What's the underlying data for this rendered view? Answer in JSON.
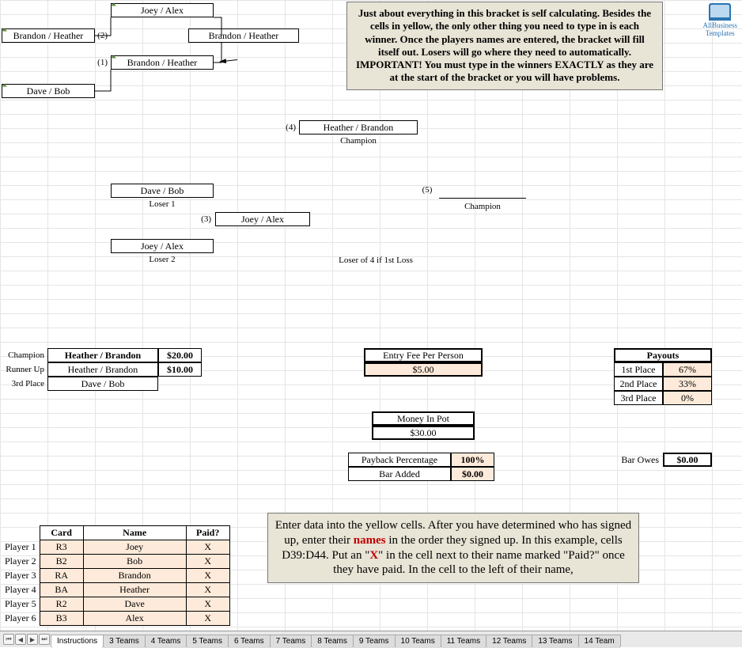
{
  "logo_text": "AllBusiness\nTemplates",
  "bracket": {
    "seed_top_left": "Brandon / Heather",
    "seed_top_right": "Joey / Alex",
    "seed_bot_left": "Dave / Bob",
    "win_r1": "Brandon / Heather",
    "win_r1b": "Brandon / Heather",
    "champ_winner_side": "Heather / Brandon",
    "champ_label": "Champion",
    "loser1_name": "Dave / Bob",
    "loser1_lbl": "Loser 1",
    "loser2_name": "Joey / Alex",
    "loser2_lbl": "Loser 2",
    "losers_final": "Joey / Alex",
    "grand_final_lbl": "Champion",
    "loser4_lbl": "Loser of 4 if 1st Loss",
    "n1": "(1)",
    "n2": "(2)",
    "n3": "(3)",
    "n4": "(4)",
    "n5": "(5)"
  },
  "results": {
    "champion_lbl": "Champion",
    "champion": "Heather / Brandon",
    "champion_pay": "$20.00",
    "runnerup_lbl": "Runner Up",
    "runnerup": "Heather / Brandon",
    "runnerup_pay": "$10.00",
    "third_lbl": "3rd Place",
    "third": "Dave / Bob"
  },
  "money": {
    "entry_lbl": "Entry Fee Per Person",
    "entry_val": "$5.00",
    "pot_lbl": "Money In Pot",
    "pot_val": "$30.00",
    "payback_lbl": "Payback Percentage",
    "payback_val": "100%",
    "baradded_lbl": "Bar Added",
    "baradded_val": "$0.00",
    "barowes_lbl": "Bar Owes",
    "barowes_val": "$0.00"
  },
  "payouts": {
    "title": "Payouts",
    "p1_lbl": "1st Place",
    "p1_val": "67%",
    "p2_lbl": "2nd Place",
    "p2_val": "33%",
    "p3_lbl": "3rd Place",
    "p3_val": "0%"
  },
  "players": {
    "headers": {
      "card": "Card",
      "name": "Name",
      "paid": "Paid?"
    },
    "rows": [
      {
        "label": "Player 1",
        "card": "R3",
        "name": "Joey",
        "paid": "X"
      },
      {
        "label": "Player 2",
        "card": "B2",
        "name": "Bob",
        "paid": "X"
      },
      {
        "label": "Player 3",
        "card": "RA",
        "name": "Brandon",
        "paid": "X"
      },
      {
        "label": "Player 4",
        "card": "BA",
        "name": "Heather",
        "paid": "X"
      },
      {
        "label": "Player 5",
        "card": "R2",
        "name": "Dave",
        "paid": "X"
      },
      {
        "label": "Player 6",
        "card": "B3",
        "name": "Alex",
        "paid": "X"
      }
    ]
  },
  "callouts": {
    "top": "Just about everything in this bracket is self calculating. Besides the cells in yellow, the only other thing you need to type in is each winner. Once the players names are entered, the bracket will fill itself out. Losers will go where they need to automatically. IMPORTANT! You must type in the winners EXACTLY as they are at the start of the bracket or you will have problems.",
    "bottom_pre": "Enter data into the yellow cells. After you have determined who has signed up, enter their ",
    "bottom_names": "names",
    "bottom_mid": " in the order they signed up. In this example, cells D39:D44. Put an \"",
    "bottom_x": "X",
    "bottom_post": "\" in the cell next to their name marked \"Paid?\" once they have paid. In the cell to the left of their name,"
  },
  "tabs": {
    "nav": [
      "⏮",
      "◀",
      "▶",
      "⏭"
    ],
    "items": [
      "Instructions",
      "3 Teams",
      "4 Teams",
      "5 Teams",
      "6 Teams",
      "7 Teams",
      "8 Teams",
      "9 Teams",
      "10 Teams",
      "11 Teams",
      "12 Teams",
      "13 Teams",
      "14 Team"
    ]
  }
}
